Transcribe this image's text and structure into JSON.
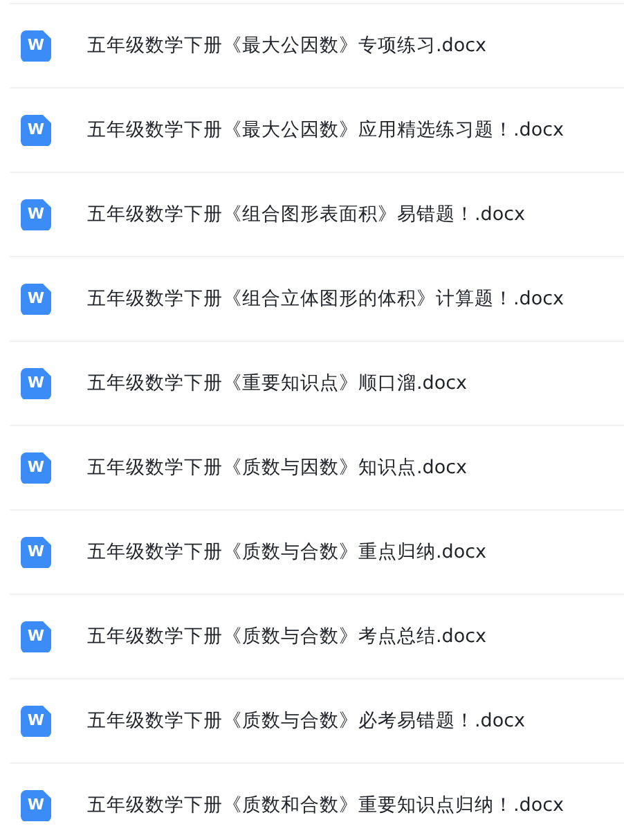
{
  "files": [
    {
      "icon_label": "W",
      "name": "五年级数学下册《最大公因数》专项练习.docx"
    },
    {
      "icon_label": "W",
      "name": "五年级数学下册《最大公因数》应用精选练习题！.docx"
    },
    {
      "icon_label": "W",
      "name": "五年级数学下册《组合图形表面积》易错题！.docx"
    },
    {
      "icon_label": "W",
      "name": "五年级数学下册《组合立体图形的体积》计算题！.docx"
    },
    {
      "icon_label": "W",
      "name": "五年级数学下册《重要知识点》顺口溜.docx"
    },
    {
      "icon_label": "W",
      "name": "五年级数学下册《质数与因数》知识点.docx"
    },
    {
      "icon_label": "W",
      "name": "五年级数学下册《质数与合数》重点归纳.docx"
    },
    {
      "icon_label": "W",
      "name": "五年级数学下册《质数与合数》考点总结.docx"
    },
    {
      "icon_label": "W",
      "name": "五年级数学下册《质数与合数》必考易错题！.docx"
    },
    {
      "icon_label": "W",
      "name": "五年级数学下册《质数和合数》重要知识点归纳！.docx"
    }
  ]
}
